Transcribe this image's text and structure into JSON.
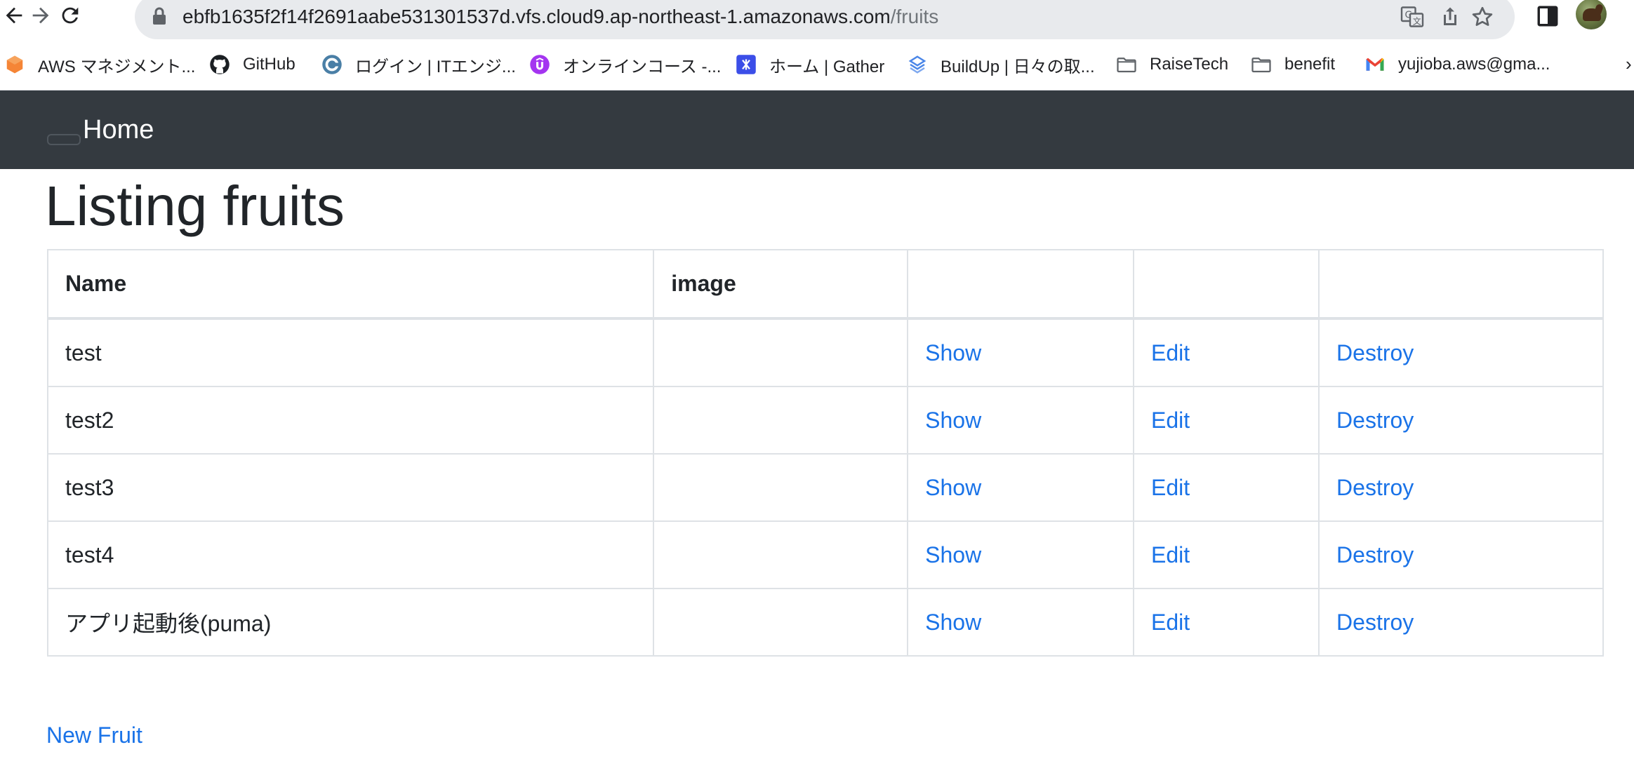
{
  "browser": {
    "url_host": "ebfb1635f2f14f2691aabe531301537d.vfs.cloud9.ap-northeast-1.amazonaws.com",
    "url_path": "/fruits",
    "icons": [
      "back-icon",
      "forward-icon",
      "reload-icon",
      "lock-icon",
      "translate-icon",
      "share-icon",
      "star-icon",
      "side-panel-icon",
      "avatar"
    ]
  },
  "bookmarks": [
    {
      "label": "AWS マネジメント...",
      "icon": "aws-icon"
    },
    {
      "label": "GitHub",
      "icon": "github-icon"
    },
    {
      "label": "ログイン | ITエンジ...",
      "icon": "login-site-icon"
    },
    {
      "label": "オンラインコース -...",
      "icon": "udemy-icon"
    },
    {
      "label": "ホーム | Gather",
      "icon": "gather-icon"
    },
    {
      "label": "BuildUp | 日々の取...",
      "icon": "buildup-icon"
    },
    {
      "label": "RaiseTech",
      "icon": "folder-icon"
    },
    {
      "label": "benefit",
      "icon": "folder-icon"
    },
    {
      "label": "yujioba.aws@gma...",
      "icon": "gmail-icon"
    }
  ],
  "navbar": {
    "brand": "Home"
  },
  "page": {
    "title": "Listing fruits",
    "table": {
      "headers": [
        "Name",
        "image",
        "",
        "",
        ""
      ],
      "rows": [
        {
          "name": "test",
          "image": "",
          "show": "Show",
          "edit": "Edit",
          "destroy": "Destroy"
        },
        {
          "name": "test2",
          "image": "",
          "show": "Show",
          "edit": "Edit",
          "destroy": "Destroy"
        },
        {
          "name": "test3",
          "image": "",
          "show": "Show",
          "edit": "Edit",
          "destroy": "Destroy"
        },
        {
          "name": "test4",
          "image": "",
          "show": "Show",
          "edit": "Edit",
          "destroy": "Destroy"
        },
        {
          "name": "アプリ起動後(puma)",
          "image": "",
          "show": "Show",
          "edit": "Edit",
          "destroy": "Destroy"
        }
      ]
    },
    "new_link": "New Fruit"
  },
  "colors": {
    "navbar_bg": "#343a40",
    "link": "#1a73e8",
    "text": "#212529",
    "border": "#dee2e6"
  }
}
